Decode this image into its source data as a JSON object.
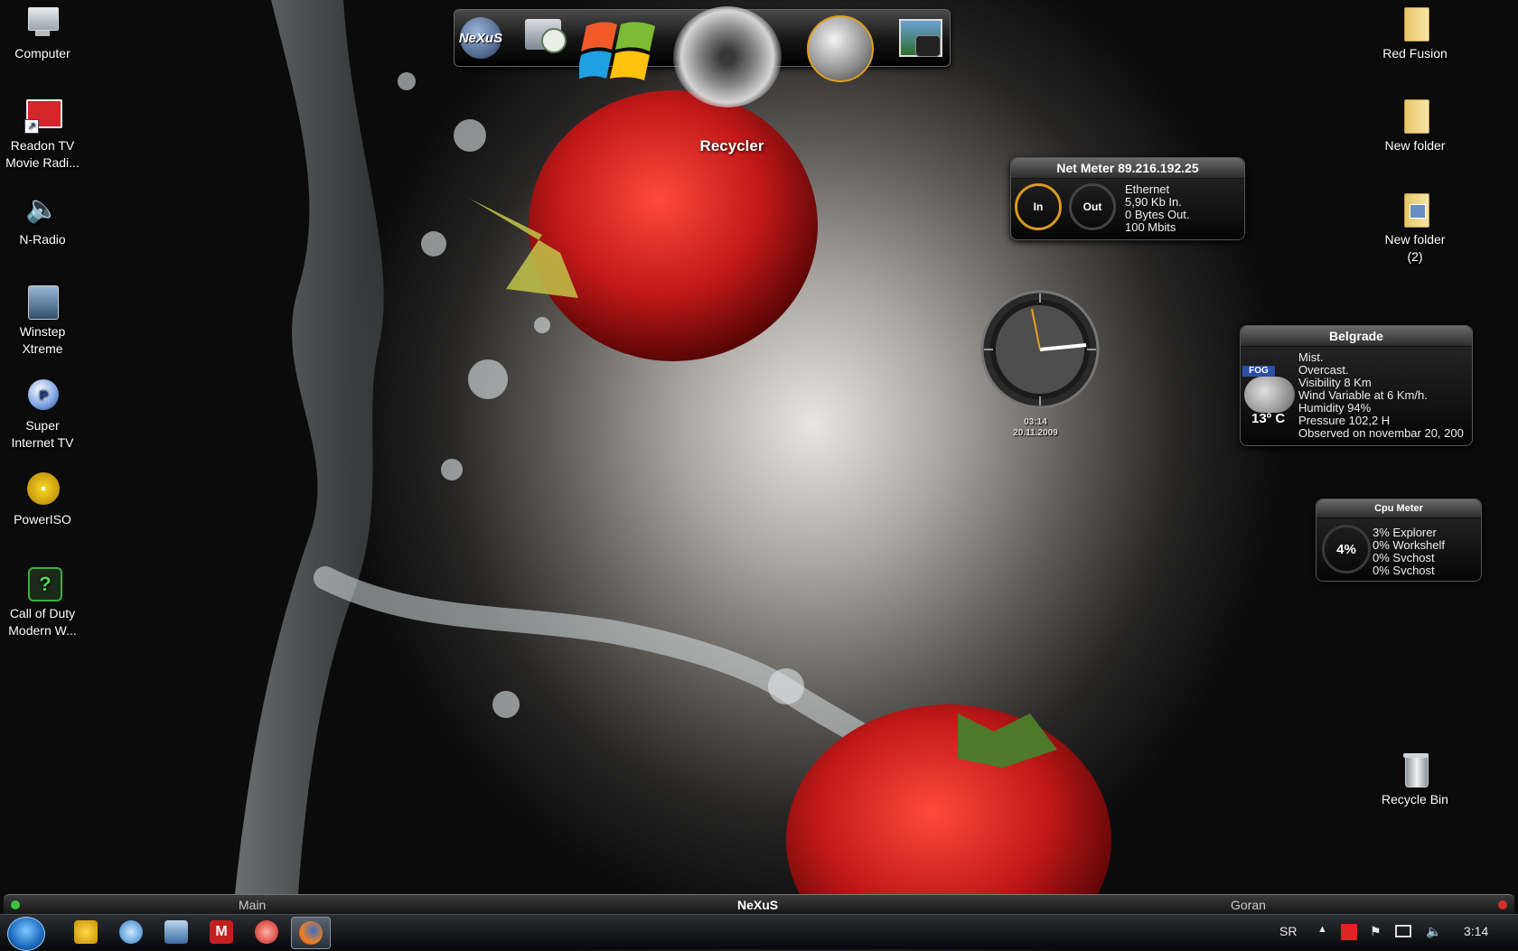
{
  "desktop_left": [
    {
      "label": "Computer",
      "icon": "computer-icon"
    },
    {
      "label": "Readon TV\nMovie Radi...",
      "icon": "readon-tv-icon"
    },
    {
      "label": "N-Radio",
      "icon": "speaker-icon"
    },
    {
      "label": "Winstep\nXtreme",
      "icon": "winstep-icon"
    },
    {
      "label": "Super\nInternet TV",
      "icon": "super-internet-tv-icon"
    },
    {
      "label": "PowerISO",
      "icon": "poweriso-icon"
    },
    {
      "label": "Call of Duty\nModern W...",
      "icon": "call-of-duty-icon"
    }
  ],
  "desktop_right": [
    {
      "label": "Red Fusion",
      "icon": "folder-icon"
    },
    {
      "label": "New folder",
      "icon": "folder-icon"
    },
    {
      "label": "New folder\n(2)",
      "icon": "folder-icon"
    },
    {
      "label": "Recycle Bin",
      "icon": "recycle-bin-icon"
    }
  ],
  "dock": {
    "items": [
      "nexus-logo-icon",
      "clock-app-icon",
      "windows-logo-icon",
      "recycler-icon",
      "globe-icon",
      "camera-icon"
    ],
    "nexus_text": "NeXuS",
    "hover_label": "Recycler"
  },
  "net_meter": {
    "title": "Net Meter 89.216.192.25",
    "in_label": "In",
    "out_label": "Out",
    "lines": [
      "Ethernet",
      "5,90 Kb In.",
      "0 Bytes Out.",
      "100 Mbits"
    ]
  },
  "clock": {
    "time": "03:14",
    "date": "20.11.2009"
  },
  "weather": {
    "city": "Belgrade",
    "badge": "FOG",
    "temp": "13º C",
    "lines": [
      "Mist.",
      "Overcast.",
      "Visibility 8 Km",
      "Wind Variable at 6 Km/h.",
      "Humidity 94%",
      "Pressure 102,2 H",
      "Observed on novembar 20, 200"
    ]
  },
  "cpu_meter": {
    "title": "Cpu Meter",
    "value": "4%",
    "lines": [
      "3% Explorer",
      "0% Workshelf",
      "0% Svchost",
      "0% Svchost"
    ]
  },
  "nexus_bar": {
    "left": "Main",
    "center": "NeXuS",
    "right": "Goran"
  },
  "taskbar": {
    "start": "start-orb-icon",
    "apps": [
      "winstep-app-icon",
      "media-player-icon",
      "explorer-icon",
      "malware-icon",
      "ccleaner-icon",
      "firefox-icon"
    ],
    "lang": "SR",
    "clock": "3:14"
  },
  "colors": {
    "accent_orange": "#e8a020",
    "strawberry": "#c01818"
  }
}
